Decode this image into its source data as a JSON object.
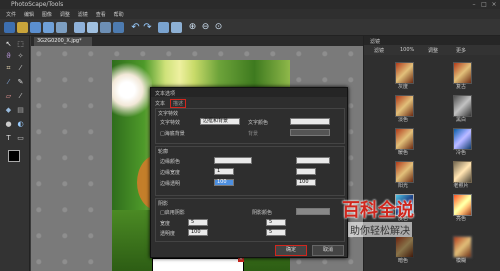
{
  "window": {
    "title": "PhotoScape/Tools"
  },
  "menu": [
    "文件",
    "编辑",
    "图像",
    "调整",
    "滤镜",
    "查看",
    "帮助"
  ],
  "document": {
    "tab_label": "3G2G0200_X.jpg*"
  },
  "dialog": {
    "title": "文本选项",
    "tabs": {
      "text": "文本",
      "effect": "描述"
    },
    "text_section": {
      "header": "文字特效",
      "effect_label": "文字特效",
      "effect_value": "边框和背景",
      "color_label": "文字颜色",
      "bg_label": "背景",
      "bg_check": "□海底背景"
    },
    "border_section": {
      "header": "轮廓",
      "color_label": "边缘颜色",
      "thickness_label": "边缘宽度",
      "thickness_value": "1",
      "opacity_label": "边缘透明",
      "opacity_value": "100",
      "opacity_value2": "100"
    },
    "shadow_section": {
      "header": "阴影",
      "enable_label": "□启用阴影",
      "color_label": "阴影颜色",
      "width_label": "宽度",
      "width_value": "5",
      "opacity_label": "透明度",
      "opacity_value": "100",
      "offset_value": "5",
      "offset_value2": "5"
    },
    "ok_label": "确定",
    "cancel_label": "取消"
  },
  "right_panel": {
    "header": "滤镜",
    "tabs": [
      "滤镜",
      "100%",
      "调整",
      "更多"
    ],
    "items": [
      "灰度",
      "复古",
      "淡色",
      "黑白",
      "暖色",
      "冷色",
      "阳光",
      "老照片",
      "反色",
      "亮色",
      "暗色",
      "模糊"
    ]
  },
  "watermark": {
    "title": "百科全说",
    "subtitle": "助你轻松解决"
  },
  "accent": "#d0271e"
}
